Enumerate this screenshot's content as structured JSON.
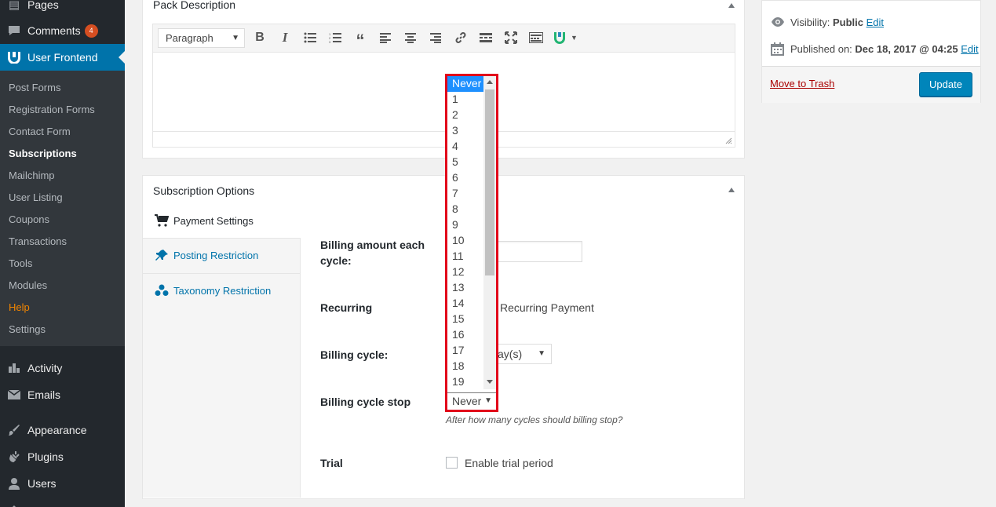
{
  "admin_menu": {
    "pages": "Pages",
    "comments": "Comments",
    "comments_count": "4",
    "user_frontend": "User Frontend",
    "submenu": [
      "Post Forms",
      "Registration Forms",
      "Contact Form",
      "Subscriptions",
      "Mailchimp",
      "User Listing",
      "Coupons",
      "Transactions",
      "Tools",
      "Modules",
      "Help",
      "Settings"
    ],
    "activity": "Activity",
    "emails": "Emails",
    "appearance": "Appearance",
    "plugins": "Plugins",
    "users": "Users"
  },
  "pack_description": {
    "title": "Pack Description",
    "format_select": "Paragraph"
  },
  "subscription_options": {
    "title": "Subscription Options",
    "tabs": [
      "Payment Settings",
      "Posting Restriction",
      "Taxonomy Restriction"
    ],
    "fields": {
      "billing_amount": "Billing amount each cycle:",
      "recurring": "Recurring",
      "recurring_checkbox": "Recurring Payment",
      "billing_cycle": "Billing cycle:",
      "billing_cycle_value": "ay(s)",
      "billing_cycle_stop": "Billing cycle stop",
      "billing_cycle_stop_value": "Never",
      "billing_cycle_stop_desc": "After how many cycles should billing stop?",
      "trial": "Trial",
      "trial_checkbox": "Enable trial period"
    },
    "dropdown_options": [
      "Never",
      "1",
      "2",
      "3",
      "4",
      "5",
      "6",
      "7",
      "8",
      "9",
      "10",
      "11",
      "12",
      "13",
      "14",
      "15",
      "16",
      "17",
      "18",
      "19"
    ]
  },
  "publish": {
    "visibility_label": "Visibility:",
    "visibility_value": "Public",
    "visibility_edit": "Edit",
    "published_label": "Published on:",
    "published_value": "Dec 18, 2017 @ 04:25",
    "published_edit": "Edit",
    "trash": "Move to Trash",
    "update": "Update"
  },
  "colors": {
    "sidebar_bg": "#23282d",
    "accent": "#0073aa",
    "highlight": "#e2001a",
    "selection": "#1e90ff"
  }
}
